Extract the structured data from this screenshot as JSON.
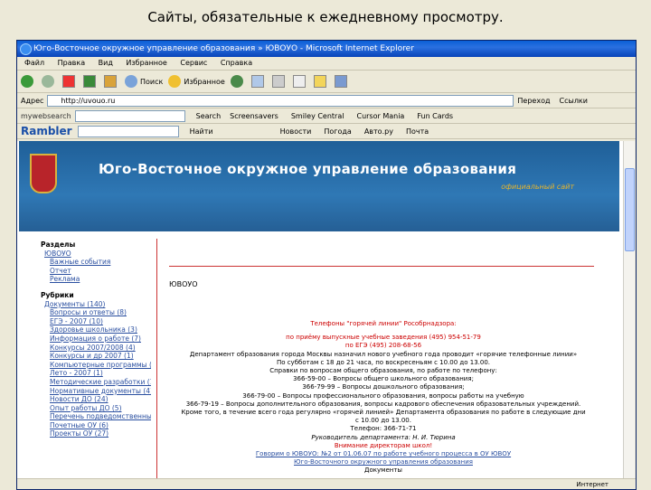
{
  "slide_title": "Сайты, обязательные к ежедневному просмотру.",
  "window_title": "Юго-Восточное окружное управление образования » ЮВОУО - Microsoft Internet Explorer",
  "menu": [
    "Файл",
    "Правка",
    "Вид",
    "Избранное",
    "Сервис",
    "Справка"
  ],
  "toolbar": {
    "back": "",
    "search": "Поиск",
    "favorites": "Избранное"
  },
  "address": {
    "label": "Адрес",
    "value": "http://uvouo.ru",
    "go": "Переход",
    "links": "Ссылки"
  },
  "mywebsearch": {
    "label": "mywebsearch",
    "search": "Search",
    "screensavers": "Screensavers",
    "smiley": "Smiley Central",
    "cursor": "Cursor Mania",
    "fun": "Fun Cards"
  },
  "rambler": {
    "logo": "Rambler",
    "find": "Найти",
    "news": "Новости",
    "weather": "Погода",
    "avto": "Авто.ру",
    "mail": "Почта"
  },
  "site": {
    "title": "Юго-Восточное окружное управление образования",
    "subtitle": "официальный сайт",
    "section": "ЮВОУО"
  },
  "sidebar": {
    "razdely_head": "Разделы",
    "razdely": [
      "ЮВОУО",
      "Важные события",
      "Отчет",
      "Реклама"
    ],
    "rubriki_head": "Рубрики",
    "rubriki": [
      "Документы (140)",
      "Вопросы и ответы (8)",
      "ЕГЭ - 2007 (10)",
      "Здоровье школьника (3)",
      "Информация о работе (7)",
      "Конкурсы 2007/2008 (4)",
      "Конкурсы и др 2007 (1)",
      "Компьютерные программы (15)",
      "Лето - 2007 (1)",
      "Методические разработки (1)",
      "Нормативные документы (4)",
      "Новости ДО (24)",
      "Опыт работы ДО (5)",
      "Перечень подведомственных ОУ (12)",
      "Почетные ОУ (6)",
      "Проекты ОУ (27)"
    ]
  },
  "main": {
    "hotline": "Телефоны \"горячей линии\" Рособрнадзора:",
    "line2": "по приёму выпускные учебные заведения (495) 954-51-79",
    "line3": "по ЕГЭ (495) 208-68-56",
    "body": [
      "Департамент образования города Москвы назначил нового учебного года проводит «горячие телефонные линии»",
      "По субботам с 18 до 21 часа, по воскресеньям с 10.00 до 13.00.",
      "Справки по вопросам общего образования, по работе по телефону:",
      "366-59-00 – Вопросы общего школьного образования;",
      "366-79-99 – Вопросы дошкольного образования;",
      "366-79-00 – Вопросы профессионального образования, вопросы работы на учебную",
      "366-79-19 – Вопросы дополнительного образования, вопросы кадрового обеспечения образовательных учреждений.",
      "Кроме того, в течение всего года регулярно «горячей линией» Департамента образования по работе в следующие дни с 10.00 до 13.00."
    ],
    "phone": "Телефон: 366-71-71",
    "director": "Руководитель департамента: Н. И. Тюрина",
    "red_footer": "Внимание директорам школ!",
    "link1": "Говорим о ЮВОУО: №2 от 01.06.07 по работе учебного процесса в ОУ ЮВОУ",
    "link2": "Юго-Восточного окружного управления образования",
    "docs": "Документы"
  },
  "status": {
    "left": "",
    "right": "Интернет"
  }
}
